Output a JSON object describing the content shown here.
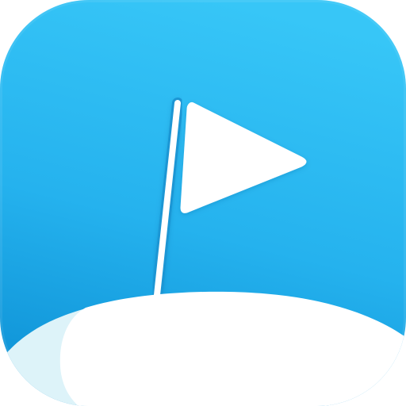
{
  "app_icon": {
    "icon": "flag-on-hill-icon",
    "colors": {
      "background_top": "#37C6F7",
      "background_mid": "#25B2EE",
      "background_bottom": "#0E92D6",
      "flag": "#FFFFFF",
      "pole": "#FFFFFF",
      "pole_outline": "#1A96D4",
      "hill": "#FFFFFF",
      "hill_shadow": "#DDF3F9"
    }
  }
}
